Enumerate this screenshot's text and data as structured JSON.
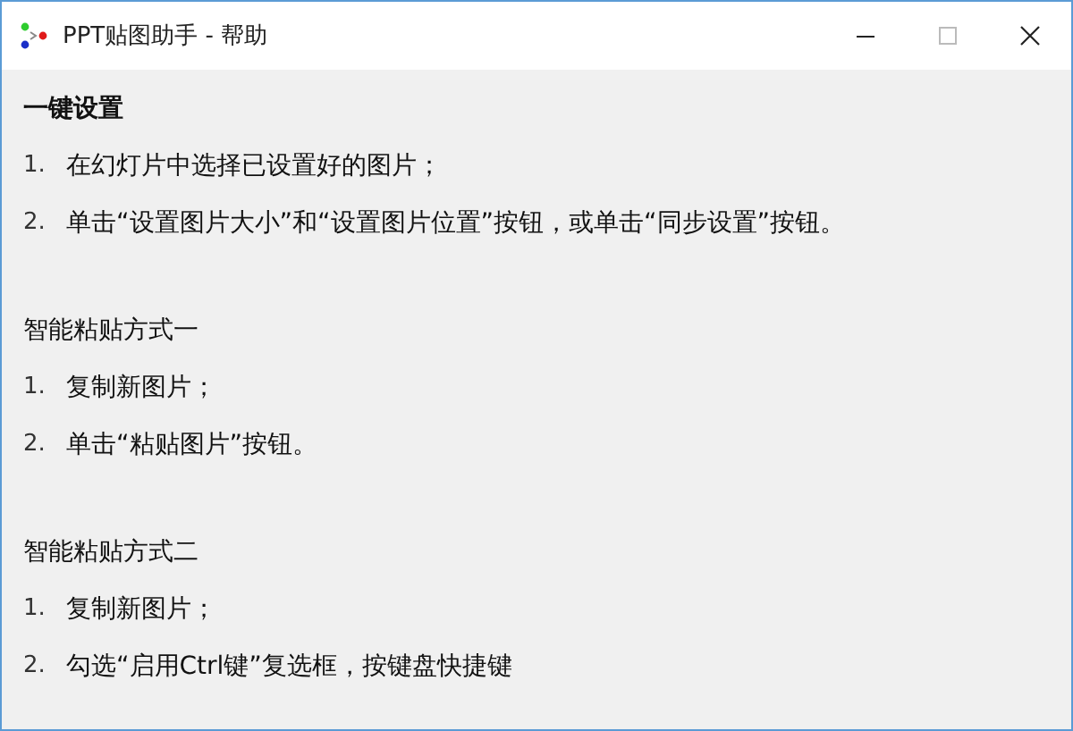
{
  "window": {
    "title": "PPT贴图助手 - 帮助"
  },
  "sections": [
    {
      "heading": "一键设置",
      "steps": [
        {
          "number": "1.",
          "text": "在幻灯片中选择已设置好的图片；"
        },
        {
          "number": "2.",
          "text": "单击“设置图片大小”和“设置图片位置”按钮，或单击“同步设置”按钮。"
        }
      ]
    },
    {
      "heading": "智能粘贴方式一",
      "steps": [
        {
          "number": "1.",
          "text": "复制新图片；"
        },
        {
          "number": "2.",
          "text": "单击“粘贴图片”按钮。"
        }
      ]
    },
    {
      "heading": "智能粘贴方式二",
      "steps": [
        {
          "number": "1.",
          "text": "复制新图片；"
        },
        {
          "number": "2.",
          "text": "勾选“启用Ctrl键”复选框，按键盘快捷键"
        }
      ]
    }
  ]
}
